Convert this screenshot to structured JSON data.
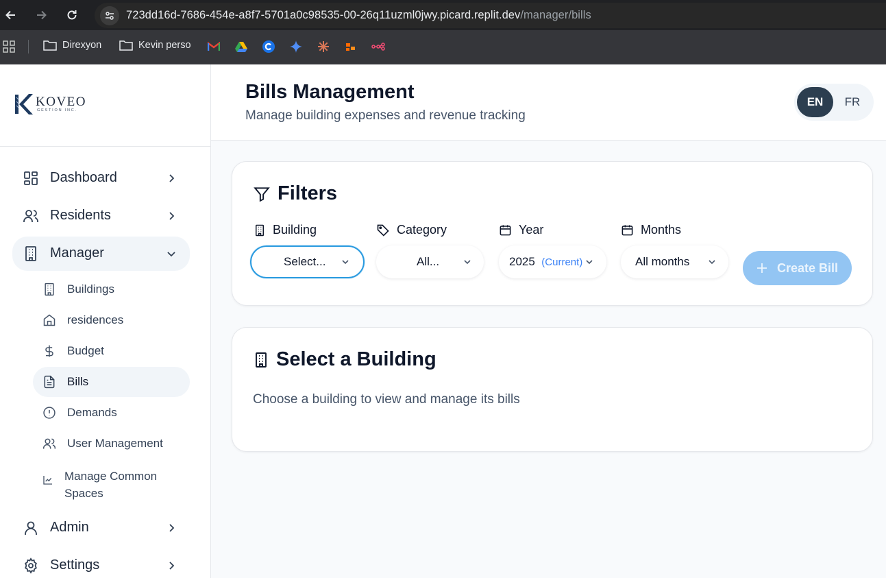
{
  "browser": {
    "url_main": "723dd16d-7686-454e-a8f7-5701a0c98535-00-26q11uzml0jwy.picard.replit.dev",
    "url_path": "/manager/bills",
    "bookmarks": [
      {
        "label": "Direxyon",
        "icon": "folder-icon"
      },
      {
        "label": "Kevin perso",
        "icon": "folder-icon"
      }
    ],
    "bookmark_icons": [
      "gmail-icon",
      "google-drive-icon",
      "c-app-icon",
      "gemini-icon",
      "claude-icon",
      "make-icon",
      "n8n-icon"
    ]
  },
  "brand": {
    "logo_letter": "K",
    "name": "KOVEO",
    "tagline": "GESTION INC."
  },
  "sidebar": {
    "items": [
      {
        "label": "Dashboard",
        "icon": "dashboard-icon"
      },
      {
        "label": "Residents",
        "icon": "users-icon"
      },
      {
        "label": "Manager",
        "icon": "building-icon"
      },
      {
        "label": "Admin",
        "icon": "user-icon"
      },
      {
        "label": "Settings",
        "icon": "gear-icon"
      }
    ],
    "manager_sub": [
      {
        "label": "Buildings",
        "icon": "building-icon"
      },
      {
        "label": "residences",
        "icon": "home-icon"
      },
      {
        "label": "Budget",
        "icon": "dollar-icon"
      },
      {
        "label": "Bills",
        "icon": "file-text-icon"
      },
      {
        "label": "Demands",
        "icon": "alert-circle-icon"
      },
      {
        "label": "User Management",
        "icon": "users-icon"
      },
      {
        "label": "Manage Common Spaces",
        "line1": "Manage Common",
        "line2": "Spaces",
        "icon": "chart-icon"
      }
    ]
  },
  "header": {
    "title": "Bills Management",
    "subtitle": "Manage building expenses and revenue tracking",
    "lang_en": "EN",
    "lang_fr": "FR"
  },
  "filters": {
    "title": "Filters",
    "building": {
      "label": "Building",
      "value": "Select..."
    },
    "category": {
      "label": "Category",
      "value": "All..."
    },
    "year": {
      "label": "Year",
      "value": "2025",
      "tag": "(Current)"
    },
    "months": {
      "label": "Months",
      "value": "All months"
    },
    "create_label": "Create Bill"
  },
  "select_building": {
    "title": "Select a Building",
    "description": "Choose a building to view and manage its bills"
  },
  "colors": {
    "accent": "#2b9be0",
    "create_button": "#93c5f3",
    "active_lang": "#2c3e50"
  }
}
